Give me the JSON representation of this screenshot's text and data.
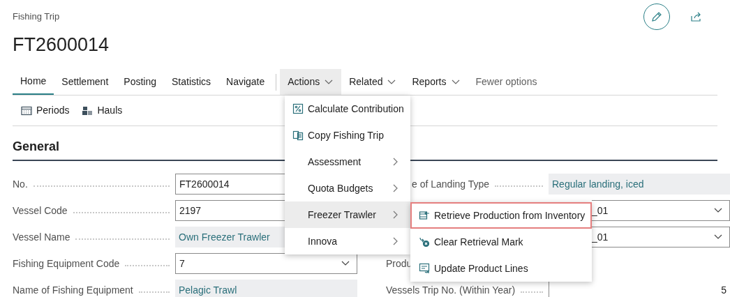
{
  "header": {
    "caption": "Fishing Trip",
    "title": "FT2600014"
  },
  "tabs": [
    {
      "label": "Home",
      "kind": "tab",
      "selected": true,
      "expanded": false
    },
    {
      "label": "Settlement",
      "kind": "tab",
      "selected": false,
      "expanded": false
    },
    {
      "label": "Posting",
      "kind": "tab",
      "selected": false,
      "expanded": false
    },
    {
      "label": "Statistics",
      "kind": "tab",
      "selected": false,
      "expanded": false
    },
    {
      "label": "Navigate",
      "kind": "tab",
      "selected": false,
      "expanded": false
    },
    {
      "label": "Actions",
      "kind": "menu",
      "selected": false,
      "expanded": true
    },
    {
      "label": "Related",
      "kind": "menu",
      "selected": false,
      "expanded": false
    },
    {
      "label": "Reports",
      "kind": "menu",
      "selected": false,
      "expanded": false
    },
    {
      "label": "Fewer options",
      "kind": "link",
      "selected": false,
      "expanded": false
    }
  ],
  "toolbar": [
    {
      "label": "Periods",
      "kind": "calendar"
    },
    {
      "label": "Hauls",
      "kind": "hauls"
    }
  ],
  "section": {
    "title": "General"
  },
  "fields_left": [
    {
      "label": "No.",
      "value": "FT2600014",
      "kind": "input"
    },
    {
      "label": "Vessel Code",
      "value": "2197",
      "kind": "input"
    },
    {
      "label": "Vessel Name",
      "value": "Own Freezer Trawler",
      "kind": "readonly"
    },
    {
      "label": "Fishing Equipment Code",
      "value": "7",
      "kind": "dropdown"
    },
    {
      "label": "Name of Fishing Equipment",
      "value": "Pelagic Trawl",
      "kind": "readonly"
    }
  ],
  "fields_right": [
    {
      "label": "e of Landing Type",
      "value": "Regular landing, iced",
      "kind": "readonly"
    },
    {
      "value": "_01",
      "kind": "dropdown"
    },
    {
      "value": "_01",
      "kind": "dropdown"
    },
    {
      "label": "Produ",
      "kind": "none"
    },
    {
      "label": "Vessels Trip No. (Within Year)",
      "value": "5",
      "kind": "number"
    }
  ],
  "actions_menu": [
    {
      "label": "Calculate Contribution",
      "kind": "percent",
      "selected": false
    },
    {
      "label": "Copy Fishing Trip",
      "kind": "copy",
      "selected": false
    },
    {
      "label": "Assessment",
      "kind": "submenu",
      "selected": false
    },
    {
      "label": "Quota Budgets",
      "kind": "submenu",
      "selected": false
    },
    {
      "label": "Freezer Trawler",
      "kind": "submenu",
      "selected": true
    },
    {
      "label": "Innova",
      "kind": "submenu",
      "selected": false
    }
  ],
  "submenu": [
    {
      "label": "Retrieve Production from Inventory",
      "kind": "retrieve",
      "focused": true
    },
    {
      "label": "Clear Retrieval Mark",
      "kind": "clear",
      "focused": false
    },
    {
      "label": "Update Product Lines",
      "kind": "update",
      "focused": false
    }
  ]
}
